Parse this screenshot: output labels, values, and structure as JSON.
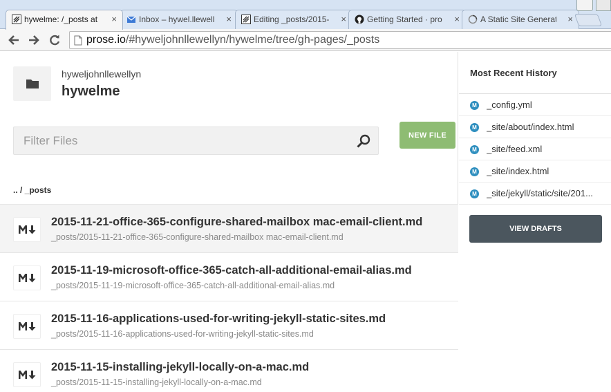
{
  "browser": {
    "tabs": [
      {
        "title": "hywelme: /_posts at",
        "icon": "prose-icon",
        "active": true
      },
      {
        "title": "Inbox – hywel.llewell",
        "icon": "mail-icon",
        "active": false
      },
      {
        "title": "Editing _posts/2015-",
        "icon": "prose-icon",
        "active": false
      },
      {
        "title": "Getting Started · pro",
        "icon": "github-icon",
        "active": false
      },
      {
        "title": "A Static Site Generat",
        "icon": "loading-icon",
        "active": false
      }
    ],
    "close_glyph": "×",
    "url_host": "prose.io",
    "url_path": "/#hyweljohnllewellyn/hywelme/tree/gh-pages/_posts"
  },
  "header": {
    "owner": "hyweljohnllewellyn",
    "repo": "hywelme"
  },
  "filter": {
    "placeholder": "Filter Files",
    "value": ""
  },
  "new_file_label": "NEW FILE",
  "breadcrumb": ".. / _posts",
  "files": [
    {
      "name": "2015-11-21-office-365-configure-shared-mailbox mac-email-client.md",
      "path": "_posts/2015-11-21-office-365-configure-shared-mailbox mac-email-client.md"
    },
    {
      "name": "2015-11-19-microsoft-office-365-catch-all-additional-email-alias.md",
      "path": "_posts/2015-11-19-microsoft-office-365-catch-all-additional-email-alias.md"
    },
    {
      "name": "2015-11-16-applications-used-for-writing-jekyll-static-sites.md",
      "path": "_posts/2015-11-16-applications-used-for-writing-jekyll-static-sites.md"
    },
    {
      "name": "2015-11-15-installing-jekyll-locally-on-a-mac.md",
      "path": "_posts/2015-11-15-installing-jekyll-locally-on-a-mac.md"
    }
  ],
  "sidebar": {
    "title": "Most Recent History",
    "history": [
      "_config.yml",
      "_site/about/index.html",
      "_site/feed.xml",
      "_site/index.html",
      "_site/jekyll/static/site/201..."
    ],
    "history_icon": "M",
    "view_drafts_label": "VIEW DRAFTS"
  },
  "colors": {
    "new_file_bg": "#8ebc73",
    "view_drafts_bg": "#4b565e",
    "history_icon_bg": "#2f8fbf"
  }
}
